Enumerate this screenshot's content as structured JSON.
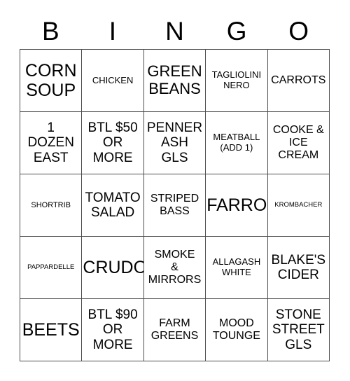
{
  "header": {
    "letters": [
      "B",
      "I",
      "N",
      "G",
      "O"
    ]
  },
  "grid": {
    "rows": [
      [
        {
          "text": "CORN\nSOUP",
          "size": "xl"
        },
        {
          "text": "CHICKEN",
          "size": "xs"
        },
        {
          "text": "GREEN\nBEANS",
          "size": "lg"
        },
        {
          "text": "TAGLIOLINI\nNERO",
          "size": "xs"
        },
        {
          "text": "CARROTS",
          "size": "sm"
        }
      ],
      [
        {
          "text": "1\nDOZEN\nEAST",
          "size": "md"
        },
        {
          "text": "BTL $50\nOR\nMORE",
          "size": "md"
        },
        {
          "text": "PENNER\nASH\nGLS",
          "size": "md"
        },
        {
          "text": "MEATBALL\n(ADD 1)",
          "size": "xs"
        },
        {
          "text": "COOKE &\nICE\nCREAM",
          "size": "sm"
        }
      ],
      [
        {
          "text": "SHORTRIB",
          "size": "xxs"
        },
        {
          "text": "TOMATO\nSALAD",
          "size": "md"
        },
        {
          "text": "STRIPED\nBASS",
          "size": "sm"
        },
        {
          "text": "FARRO",
          "size": "xl"
        },
        {
          "text": "KROMBACHER",
          "size": "tiny"
        }
      ],
      [
        {
          "text": "PAPPARDELLE",
          "size": "tiny"
        },
        {
          "text": "CRUDO",
          "size": "xl"
        },
        {
          "text": "SMOKE\n&\nMIRRORS",
          "size": "sm"
        },
        {
          "text": "ALLAGASH\nWHITE",
          "size": "xs"
        },
        {
          "text": "BLAKE'S\nCIDER",
          "size": "md"
        }
      ],
      [
        {
          "text": "BEETS",
          "size": "xl"
        },
        {
          "text": "BTL $90\nOR\nMORE",
          "size": "md"
        },
        {
          "text": "FARM\nGREENS",
          "size": "sm"
        },
        {
          "text": "MOOD\nTOUNGE",
          "size": "sm"
        },
        {
          "text": "STONE\nSTREET\nGLS",
          "size": "md"
        }
      ]
    ]
  },
  "colors": {
    "grid_line": "#4d4d4d",
    "text": "#000000",
    "background": "#ffffff"
  }
}
